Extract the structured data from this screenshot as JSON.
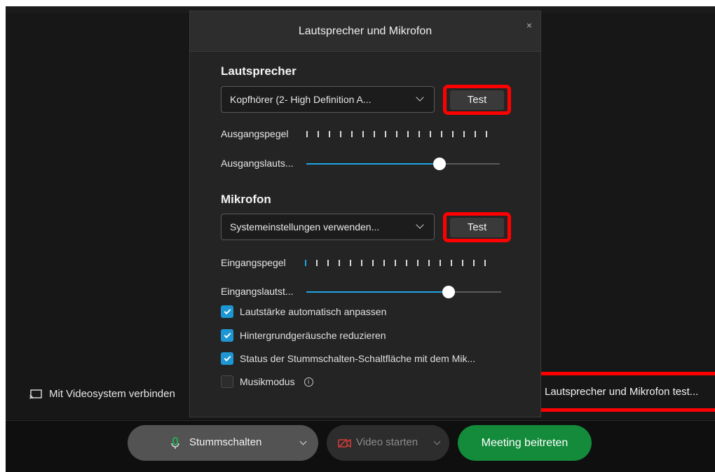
{
  "modal": {
    "title": "Lautsprecher und Mikrofon",
    "close_glyph": "×",
    "speaker": {
      "title": "Lautsprecher",
      "device": "Kopfhörer (2- High Definition A...",
      "test_label": "Test",
      "output_level_label": "Ausgangspegel",
      "output_volume_label": "Ausgangslauts...",
      "output_volume_fraction": 0.69
    },
    "microphone": {
      "title": "Mikrofon",
      "device": "Systemeinstellungen verwenden...",
      "test_label": "Test",
      "input_level_label": "Eingangspegel",
      "input_volume_label": "Eingangslautst...",
      "input_volume_fraction": 0.73,
      "input_level_active_ticks": 1
    },
    "options": [
      {
        "label": "Lautstärke automatisch anpassen",
        "checked": true
      },
      {
        "label": "Hintergrundgeräusche reduzieren",
        "checked": true
      },
      {
        "label": "Status der Stummschalten-Schaltfläche mit dem Mik...",
        "checked": true
      },
      {
        "label": "Musikmodus",
        "checked": false
      }
    ]
  },
  "stage": {
    "video_system_label": "Mit Videosystem verbinden",
    "speaker_mic_test_link": "Lautsprecher und Mikrofon test..."
  },
  "controls": {
    "mute_label": "Stummschalten",
    "video_label": "Video starten",
    "join_label": "Meeting beitreten"
  },
  "colors": {
    "accent_blue": "#1ea4e3",
    "join_green": "#138b3b",
    "highlight_red": "#ff0000"
  }
}
